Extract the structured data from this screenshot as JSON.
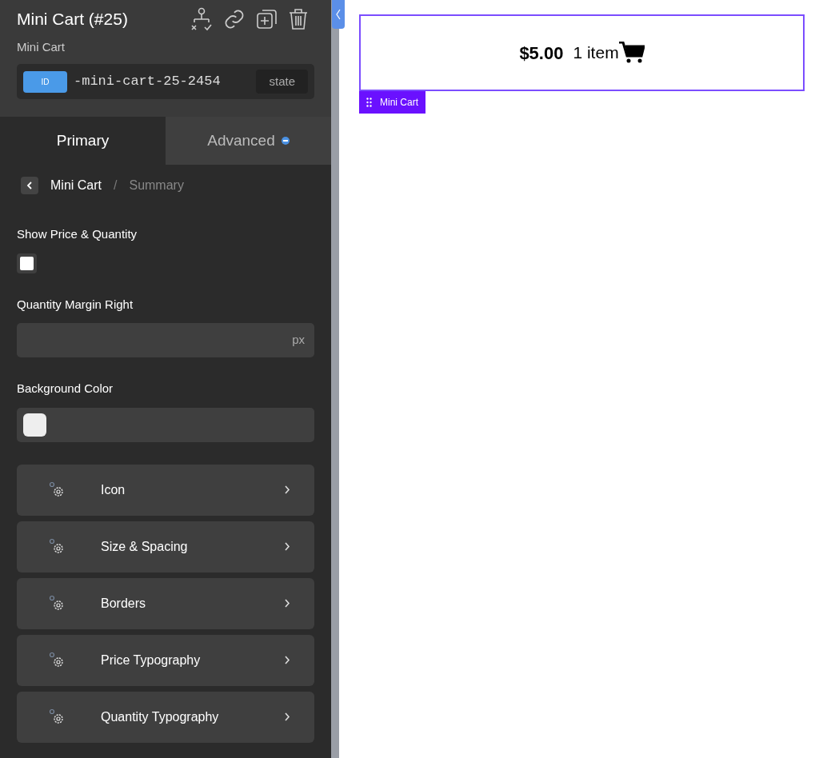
{
  "header": {
    "title": "Mini Cart (#25)",
    "subtitle": "Mini Cart",
    "id_badge": "ID",
    "id_value": "-mini-cart-25-2454",
    "state_button": "state"
  },
  "tabs": [
    {
      "label": "Primary",
      "selected": true
    },
    {
      "label": "Advanced",
      "selected": false
    }
  ],
  "breadcrumb": {
    "items": [
      "Mini Cart",
      "Summary"
    ],
    "separator": "/"
  },
  "fields": [
    {
      "kind": "checkbox",
      "label": "Show Price & Quantity",
      "checked": false
    },
    {
      "kind": "input",
      "label": "Quantity Margin Right",
      "unit": "px"
    },
    {
      "kind": "color",
      "label": "Background Color",
      "color": "#eeeeee"
    }
  ],
  "sections": [
    "Icon",
    "Size & Spacing",
    "Borders",
    "Price Typography",
    "Quantity Typography"
  ],
  "canvas": {
    "price": "$5.00",
    "quantity": "1 item",
    "element_label": "Mini Cart"
  }
}
